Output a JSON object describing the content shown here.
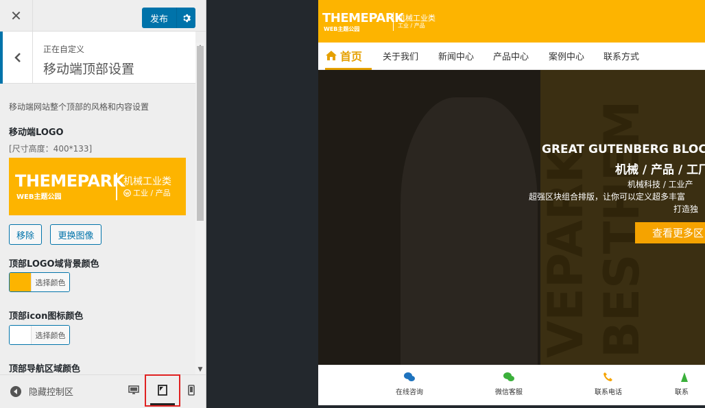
{
  "panel": {
    "publish_label": "发布",
    "crumb": "正在自定义",
    "section_title": "移动端顶部设置",
    "description": "移动端网站整个顶部的风格和内容设置",
    "logo_label": "移动端LOGO",
    "size_note": "[尺寸高度：400*133]",
    "logo": {
      "main": "THEMEPARK",
      "sub": "WEB主题公园",
      "category": "机械工业类",
      "tags": "工业 / 产品"
    },
    "remove_label": "移除",
    "change_label": "更换图像",
    "bg_color_label": "顶部LOGO域背景颜色",
    "icon_color_label": "顶部icon图标颜色",
    "nav_color_label": "顶部导航区域颜色",
    "select_color_label": "选择颜色",
    "hide_controls_label": "隐藏控制区",
    "colors": {
      "accent": "#0073aa",
      "logo_bg": "#fdb400",
      "white": "#ffffff"
    }
  },
  "preview": {
    "logo": {
      "main": "THEMEPARK",
      "sub": "WEB主题公园",
      "category": "机械工业类",
      "tags": "工业 / 产品"
    },
    "nav": [
      "首页",
      "关于我们",
      "新闻中心",
      "产品中心",
      "案例中心",
      "联系方式"
    ],
    "hero": {
      "h1": "GREAT GUTENBERG BLOC",
      "h2": "机械 / 产品 / 工厂",
      "p1": "机械科技 / 工业产",
      "p2": "超强区块组合排版，让你可以定义超多丰富",
      "p3": "打造独",
      "cta": "查看更多区",
      "bg_text": "VEPARK BESTHEM"
    },
    "bottom": [
      "在线咨询",
      "微信客服",
      "联系电话",
      "联系"
    ]
  }
}
